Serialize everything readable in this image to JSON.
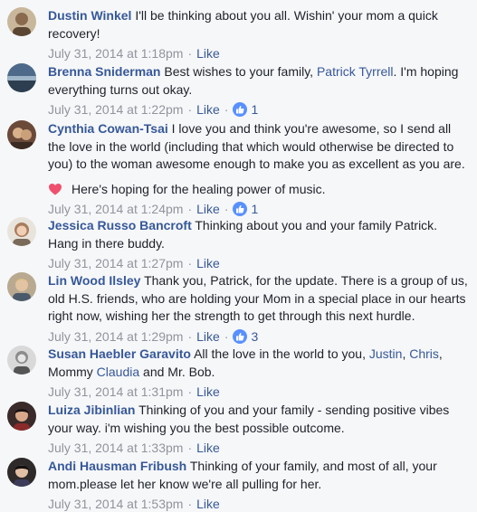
{
  "comments": [
    {
      "author": "Dustin Winkel",
      "text": "I'll be thinking about you all. Wishin' your mom a quick recovery!",
      "time": "July 31, 2014 at 1:18pm",
      "like_label": "Like"
    },
    {
      "author": "Brenna Sniderman",
      "text_before": "Best wishes to your family,",
      "mention": "Patrick Tyrrell",
      "text_after": ". I'm hoping everything turns out okay.",
      "time": "July 31, 2014 at 1:22pm",
      "like_label": "Like",
      "like_count": "1"
    },
    {
      "author": "Cynthia Cowan-Tsai",
      "text": "I love you and think you're awesome, so I send all the love in the world (including that which would otherwise be directed to you) to the woman awesome enough to make you as excellent as you are.",
      "extra": "Here's hoping for the healing power of music.",
      "time": "July 31, 2014 at 1:24pm",
      "like_label": "Like",
      "like_count": "1"
    },
    {
      "author": "Jessica Russo Bancroft",
      "text": "Thinking about you and your family Patrick. Hang in there buddy.",
      "time": "July 31, 2014 at 1:27pm",
      "like_label": "Like"
    },
    {
      "author": "Lin Wood Ilsley",
      "text": "Thank you, Patrick, for the update. There is a group of us, old H.S. friends, who are holding your Mom in a special place in our hearts right now, wishing her the strength to get through this next hurdle.",
      "time": "July 31, 2014 at 1:29pm",
      "like_label": "Like",
      "like_count": "3"
    },
    {
      "author": "Susan Haebler Garavito",
      "text_a": "All the love in the world to you,",
      "mention_a": "Justin",
      "text_b": ",",
      "mention_b": "Chris",
      "text_c": ", Mommy",
      "mention_c": "Claudia",
      "text_d": "and Mr. Bob.",
      "time": "July 31, 2014 at 1:31pm",
      "like_label": "Like"
    },
    {
      "author": "Luiza Jibinlian",
      "text": "Thinking of you and your family - sending positive vibes your way. i'm wishing you the best possible outcome.",
      "time": "July 31, 2014 at 1:33pm",
      "like_label": "Like"
    },
    {
      "author": "Andi Hausman Fribush",
      "text": "Thinking of your family, and most of all, your mom.please let her know we're all pulling for her.",
      "time": "July 31, 2014 at 1:53pm",
      "like_label": "Like"
    }
  ],
  "separator": "·",
  "colors": {
    "author": "#365899",
    "meta": "#90949c",
    "like_badge": "#5890ff",
    "heart": "#f0506e"
  }
}
